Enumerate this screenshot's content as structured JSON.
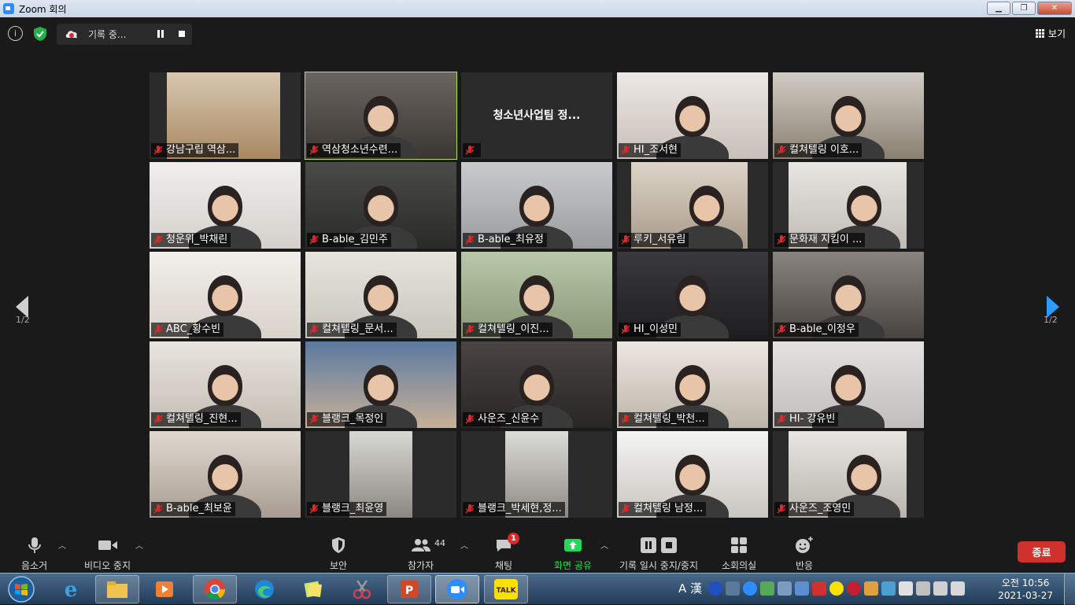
{
  "window": {
    "title": "Zoom 회의"
  },
  "topbar": {
    "recording_label": "기록 중...",
    "view_label": "보기"
  },
  "gallery": {
    "page_indicator": "1/2",
    "tiles": [
      {
        "name": "강남구립 역삼...",
        "active": false
      },
      {
        "name": "역삼청소년수련...",
        "active": true
      },
      {
        "name": "청소년사업팀 정...",
        "active": false,
        "center_label": "청소년사업팀 정..."
      },
      {
        "name": "HI_조서현",
        "active": false
      },
      {
        "name": "컬쳐텔링 이호...",
        "active": false
      },
      {
        "name": "청운위_박채린",
        "active": false
      },
      {
        "name": "B-able_김민주",
        "active": false
      },
      {
        "name": "B-able_최유정",
        "active": false
      },
      {
        "name": "루키_서유림",
        "active": false
      },
      {
        "name": "문화재 지킴이 ...",
        "active": false
      },
      {
        "name": "ABC_황수빈",
        "active": false
      },
      {
        "name": "컬쳐텔링_문서...",
        "active": false
      },
      {
        "name": "컬쳐텔링_이진...",
        "active": false
      },
      {
        "name": "HI_이성민",
        "active": false
      },
      {
        "name": "B-able_이정우",
        "active": false
      },
      {
        "name": "컬쳐텔링_진현...",
        "active": false
      },
      {
        "name": "블랭크_목정인",
        "active": false
      },
      {
        "name": "사운즈_신윤수",
        "active": false
      },
      {
        "name": "컬쳐텔링_박천...",
        "active": false
      },
      {
        "name": "HI- 강유빈",
        "active": false
      },
      {
        "name": "B-able_최보윤",
        "active": false
      },
      {
        "name": "블랭크_최윤영",
        "active": false
      },
      {
        "name": "블랭크_박세현,정...",
        "active": false
      },
      {
        "name": "컬쳐텔링 남정...",
        "active": false
      },
      {
        "name": "사운즈_조영민",
        "active": false
      }
    ]
  },
  "toolbar": {
    "mute_label": "음소거",
    "video_label": "비디오 중지",
    "security_label": "보안",
    "participants_label": "참가자",
    "participants_count": "44",
    "chat_label": "채팅",
    "chat_badge": "1",
    "share_label": "화면 공유",
    "record_label": "기록 일시 중지/중지",
    "breakout_label": "소회의실",
    "reactions_label": "반응",
    "end_label": "종료"
  },
  "taskbar": {
    "clock_time": "오전 10:56",
    "clock_date": "2021-03-27",
    "ime_label": "A 漢"
  },
  "colors": {
    "active_speaker": "#b7e04f",
    "share_green": "#23d959",
    "end_red": "#d1312c",
    "mute_red": "#e02828"
  }
}
